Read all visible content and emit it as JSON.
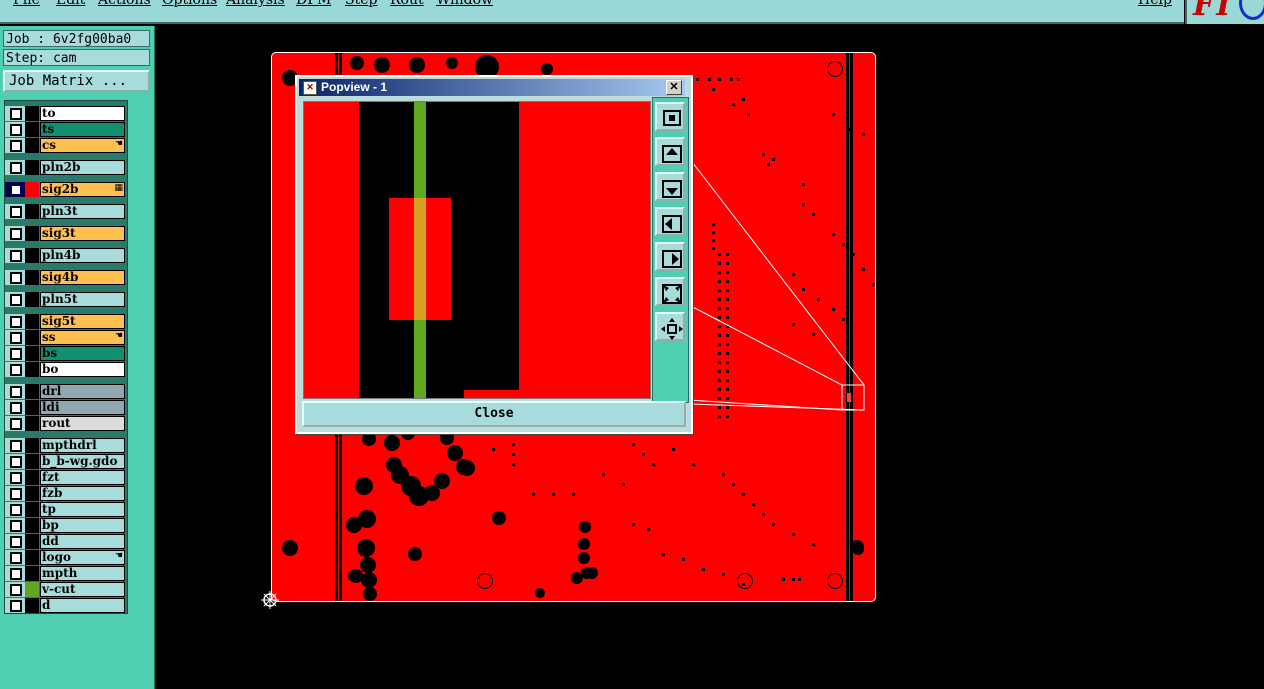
{
  "menubar": {
    "items": [
      "File",
      "Edit",
      "Actions",
      "Options",
      "Analysis",
      "DFM",
      "Step",
      "Rout",
      "Window"
    ],
    "help": "Help"
  },
  "logo": {
    "text": "FT"
  },
  "job": {
    "label": "Job : 6v2fg00ba0"
  },
  "step": {
    "label": "Step: cam"
  },
  "job_matrix": {
    "label": "Job Matrix ..."
  },
  "layers": [
    {
      "name": "to",
      "color": "#ffffff"
    },
    {
      "name": "ts",
      "color": "#109070"
    },
    {
      "name": "cs",
      "color": "#ffc050",
      "mark": "hand"
    },
    {
      "name": "pln2b",
      "color": "#a8dcdc"
    },
    {
      "name": "sig2b",
      "color": "#ffc050",
      "active": true,
      "mark": "grid"
    },
    {
      "name": "pln3t",
      "color": "#a8dcdc"
    },
    {
      "name": "sig3t",
      "color": "#ffc050"
    },
    {
      "name": "pln4b",
      "color": "#a8dcdc"
    },
    {
      "name": "sig4b",
      "color": "#ffc050"
    },
    {
      "name": "pln5t",
      "color": "#a8dcdc"
    },
    {
      "name": "sig5t",
      "color": "#ffc050"
    },
    {
      "name": "ss",
      "color": "#ffc050",
      "mark": "hand"
    },
    {
      "name": "bs",
      "color": "#109070"
    },
    {
      "name": "bo",
      "color": "#ffffff"
    },
    {
      "name": "drl",
      "color": "#90a8b0"
    },
    {
      "name": "ldi",
      "color": "#90a8b0"
    },
    {
      "name": "rout",
      "color": "#dcdcdc"
    },
    {
      "name": "mpthdrl",
      "color": "#a8dcdc"
    },
    {
      "name": "b_b-wg.gdo",
      "color": "#a8dcdc"
    },
    {
      "name": "fzt",
      "color": "#a8dcdc"
    },
    {
      "name": "fzb",
      "color": "#a8dcdc"
    },
    {
      "name": "tp",
      "color": "#a8dcdc"
    },
    {
      "name": "bp",
      "color": "#a8dcdc"
    },
    {
      "name": "dd",
      "color": "#a8dcdc"
    },
    {
      "name": "logo",
      "color": "#a8dcdc",
      "mark": "hand"
    },
    {
      "name": "mpth",
      "color": "#a8dcdc"
    },
    {
      "name": "v-cut",
      "color": "#a8dcdc",
      "swatch": "#60a820"
    },
    {
      "name": "d",
      "color": "#a8dcdc"
    }
  ],
  "popview": {
    "title": "Popview - 1",
    "close_label": "Close",
    "tools": [
      "zoom-fit-icon",
      "pan-up-icon",
      "pan-down-icon",
      "pan-left-icon",
      "pan-right-icon",
      "zoom-out-icon",
      "zoom-in-icon"
    ]
  },
  "colors": {
    "board": "#ff0000",
    "panel": "#4fcfb0",
    "button": "#a8dcdc",
    "trace_green": "#60a820"
  }
}
